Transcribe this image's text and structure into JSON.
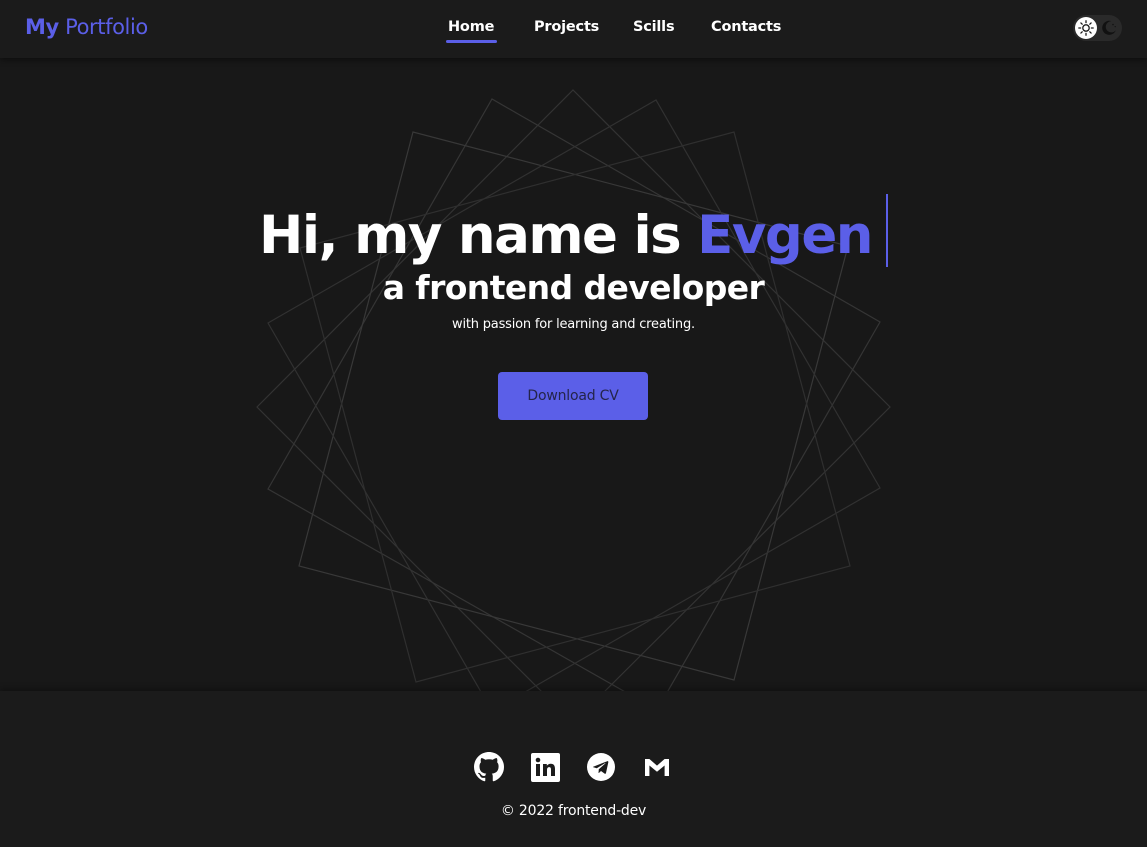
{
  "colors": {
    "accent": "#5b5fe8",
    "background": "#181818",
    "header_bg": "#1b1b1b",
    "text": "#ffffff"
  },
  "header": {
    "logo_strong": "My",
    "logo_light": "Portfolio",
    "nav": [
      {
        "label": "Home",
        "active": true
      },
      {
        "label": "Projects",
        "active": false
      },
      {
        "label": "Scills",
        "active": false
      },
      {
        "label": "Contacts",
        "active": false
      }
    ],
    "theme_toggle": {
      "light_icon": "sun-icon",
      "dark_icon": "moon-icon",
      "current": "light"
    }
  },
  "hero": {
    "greeting": "Hi, my name is",
    "name": "Evgen",
    "role": "a frontend developer",
    "tagline": "with passion for learning and creating.",
    "cta_label": "Download CV"
  },
  "footer": {
    "socials": [
      {
        "icon": "github-icon"
      },
      {
        "icon": "linkedin-icon"
      },
      {
        "icon": "telegram-icon"
      },
      {
        "icon": "gmail-icon"
      }
    ],
    "copyright": "© 2022 frontend-dev"
  }
}
